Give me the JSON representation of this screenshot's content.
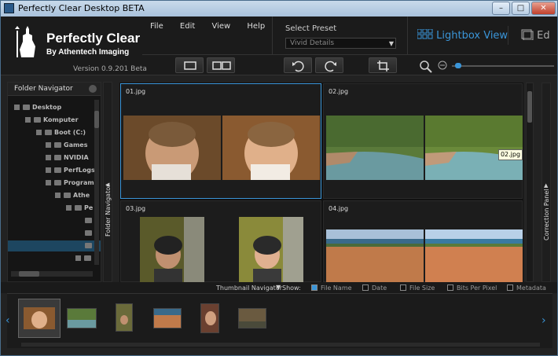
{
  "window": {
    "title": "Perfectly Clear Desktop BETA"
  },
  "brand": {
    "name": "Perfectly Clear",
    "byline": "By Athentech Imaging",
    "version": "Version 0.9.201 Beta"
  },
  "menu": [
    "File",
    "Edit",
    "View",
    "Help"
  ],
  "preset": {
    "label": "Select Preset",
    "value": "Vivid Details"
  },
  "views": {
    "lightbox": "Lightbox View",
    "edit": "Ed"
  },
  "folder_navigator": {
    "title": "Folder Navigator",
    "items": [
      "Desktop",
      "Komputer",
      "Boot (C:)",
      "Games",
      "NVIDIA",
      "PerfLogs",
      "Program",
      "Athe",
      "Pe"
    ]
  },
  "side_labels": {
    "left": "Folder Navigator",
    "right": "Correction Panel"
  },
  "images": [
    {
      "label": "01.jpg",
      "subject": "baby"
    },
    {
      "label": "02.jpg",
      "subject": "river"
    },
    {
      "label": "03.jpg",
      "subject": "child"
    },
    {
      "label": "04.jpg",
      "subject": "town"
    }
  ],
  "tooltip": "02.jpg",
  "thumbnail_navigator": {
    "title": "Thumbnail Navigator",
    "show_label": "Show:",
    "options": [
      {
        "label": "File Name",
        "checked": true
      },
      {
        "label": "Date",
        "checked": false
      },
      {
        "label": "File Size",
        "checked": false
      },
      {
        "label": "Bits Per Pixel",
        "checked": false
      },
      {
        "label": "Metadata",
        "checked": false
      }
    ]
  },
  "colors": {
    "accent": "#3a95d8",
    "background": "#222222"
  }
}
